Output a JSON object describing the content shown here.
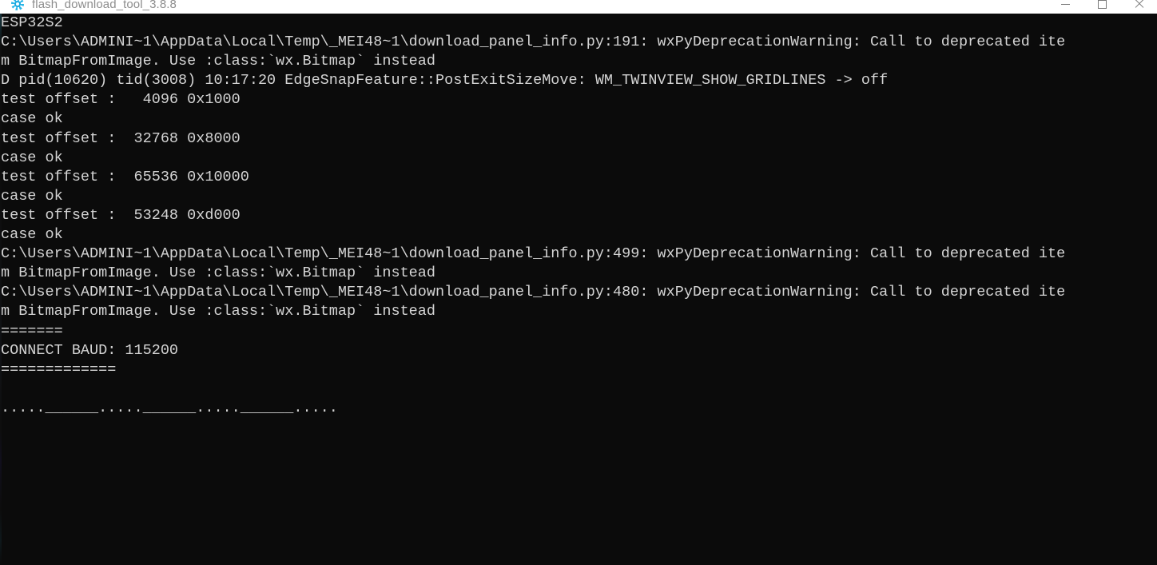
{
  "window": {
    "title": "flash_download_tool_3.8.8",
    "icon": "gear-icon",
    "controls": {
      "minimize_label": "—",
      "maximize_label": "□",
      "close_label": "✕"
    }
  },
  "console": {
    "lines": [
      "ESP32S2",
      "C:\\Users\\ADMINI~1\\AppData\\Local\\Temp\\_MEI48~1\\download_panel_info.py:191: wxPyDeprecationWarning: Call to deprecated item BitmapFromImage. Use :class:`wx.Bitmap` instead",
      "m BitmapFromImage. Use :class:`wx.Bitmap` instead",
      "D pid(10620) tid(3008) 10:17:20 EdgeSnapFeature::PostExitSizeMove: WM_TWINVIEW_SHOW_GRIDLINES -> off",
      "test offset :   4096 0x1000",
      "case ok",
      "test offset :  32768 0x8000",
      "case ok",
      "test offset :  65536 0x10000",
      "case ok",
      "test offset :  53248 0xd000",
      "case ok",
      "C:\\Users\\ADMINI~1\\AppData\\Local\\Temp\\_MEI48~1\\download_panel_info.py:499: wxPyDeprecationWarning: Call to deprecated item BitmapFromImage. Use :class:`wx.Bitmap` instead",
      "m BitmapFromImage. Use :class:`wx.Bitmap` instead",
      "C:\\Users\\ADMINI~1\\AppData\\Local\\Temp\\_MEI48~1\\download_panel_info.py:480: wxPyDeprecationWarning: Call to deprecated item BitmapFromImage. Use :class:`wx.Bitmap` instead",
      "m BitmapFromImage. Use :class:`wx.Bitmap` instead",
      "=======",
      "CONNECT BAUD: 115200",
      "=============",
      "",
      ".....______.....______.....______....."
    ],
    "raw_wrapped_lines": [
      "ESP32S2",
      "C:\\Users\\ADMINI~1\\AppData\\Local\\Temp\\_MEI48~1\\download_panel_info.py:191: wxPyDeprecationWarning: Call to deprecated ite",
      "m BitmapFromImage. Use :class:`wx.Bitmap` instead",
      "D pid(10620) tid(3008) 10:17:20 EdgeSnapFeature::PostExitSizeMove: WM_TWINVIEW_SHOW_GRIDLINES -> off",
      "test offset :   4096 0x1000",
      "case ok",
      "test offset :  32768 0x8000",
      "case ok",
      "test offset :  65536 0x10000",
      "case ok",
      "test offset :  53248 0xd000",
      "case ok",
      "C:\\Users\\ADMINI~1\\AppData\\Local\\Temp\\_MEI48~1\\download_panel_info.py:499: wxPyDeprecationWarning: Call to deprecated ite",
      "m BitmapFromImage. Use :class:`wx.Bitmap` instead",
      "C:\\Users\\ADMINI~1\\AppData\\Local\\Temp\\_MEI48~1\\download_panel_info.py:480: wxPyDeprecationWarning: Call to deprecated ite",
      "m BitmapFromImage. Use :class:`wx.Bitmap` instead",
      "=======",
      "CONNECT BAUD: 115200",
      "=============",
      "",
      ".....______.....______.....______....."
    ],
    "connect_baud": "115200",
    "chip": "ESP32S2",
    "timestamp": "10:17:20",
    "pid": "10620",
    "tid": "3008",
    "test_offsets": [
      {
        "decimal": "4096",
        "hex": "0x1000",
        "result": "case ok"
      },
      {
        "decimal": "32768",
        "hex": "0x8000",
        "result": "case ok"
      },
      {
        "decimal": "65536",
        "hex": "0x10000",
        "result": "case ok"
      },
      {
        "decimal": "53248",
        "hex": "0xd000",
        "result": "case ok"
      }
    ],
    "colors": {
      "background": "#0b0b0b",
      "text": "#d4d4d4",
      "titlebar_background": "#ffffff",
      "titlebar_text": "#8d8d8d",
      "icon_accent": "#29b6e8"
    }
  }
}
